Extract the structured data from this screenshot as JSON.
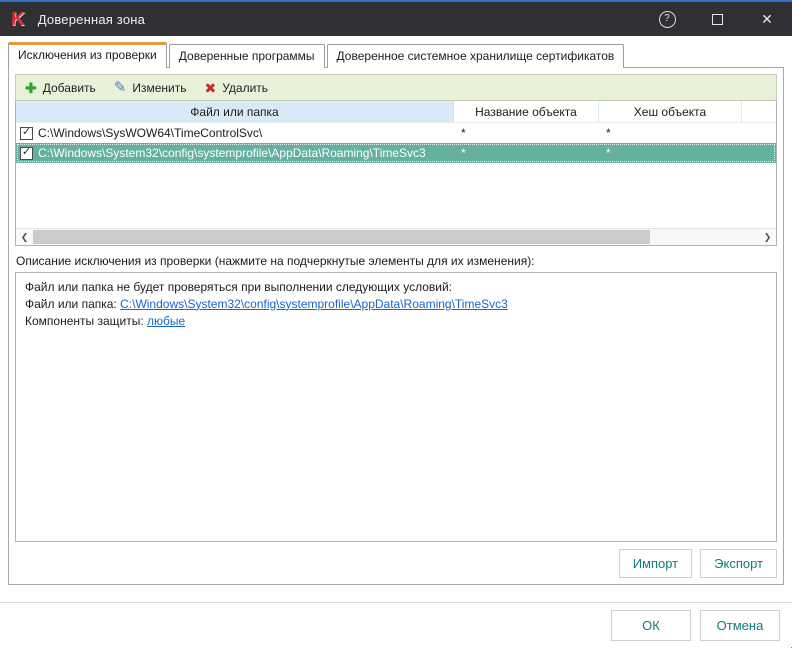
{
  "window": {
    "title": "Доверенная зона"
  },
  "icons": {
    "logo_letter": "K",
    "help": "?",
    "close": "✕",
    "add": "✚",
    "edit": "✎",
    "delete": "✖",
    "check": "✓",
    "scroll_left": "❮",
    "scroll_right": "❯"
  },
  "tabs": [
    {
      "label": "Исключения из проверки",
      "active": true
    },
    {
      "label": "Доверенные программы",
      "active": false
    },
    {
      "label": "Доверенное системное хранилище сертификатов",
      "active": false
    }
  ],
  "toolbar": {
    "add_label": "Добавить",
    "edit_label": "Изменить",
    "delete_label": "Удалить"
  },
  "table": {
    "columns": [
      "Файл или папка",
      "Название объекта",
      "Хеш объекта"
    ],
    "rows": [
      {
        "checked": true,
        "selected": false,
        "path": "C:\\Windows\\SysWOW64\\TimeControlSvc\\",
        "name": "*",
        "hash": "*"
      },
      {
        "checked": true,
        "selected": true,
        "path": "C:\\Windows\\System32\\config\\systemprofile\\AppData\\Roaming\\TimeSvc3",
        "name": "*",
        "hash": "*"
      }
    ]
  },
  "description": {
    "label": "Описание исключения из проверки (нажмите на подчеркнутые элементы для их изменения):",
    "line1": "Файл или папка не будет проверяться при выполнении следующих условий:",
    "line2_prefix": "Файл или папка: ",
    "line2_link": "C:\\Windows\\System32\\config\\systemprofile\\AppData\\Roaming\\TimeSvc3",
    "line3_prefix": "Компоненты защиты: ",
    "line3_link": "любые"
  },
  "buttons": {
    "import": "Импорт",
    "export": "Экспорт",
    "ok": "ОК",
    "cancel": "Отмена"
  },
  "colors": {
    "titlebar_bg": "#303034",
    "accent_top_line": "#2d71c8",
    "tab_active_top": "#e79a3c",
    "toolbar_bg": "#e9f1da",
    "header_sorted_col_bg": "#d9eaf7",
    "row_selected_bg": "#64b1a1",
    "link": "#1766c5",
    "button_text": "#0f7c7c"
  }
}
